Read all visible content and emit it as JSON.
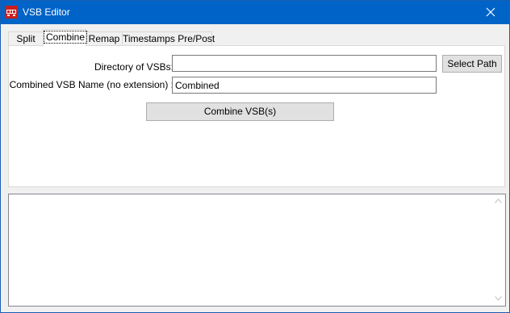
{
  "window": {
    "title": "VSB Editor",
    "accent_color": "#0063c7",
    "icons": {
      "app": "vsb-app-icon",
      "close": "close-icon"
    }
  },
  "tabs": [
    {
      "label": "Split",
      "active": false
    },
    {
      "label": "Combine",
      "active": true
    },
    {
      "label": "Remap",
      "active": false
    },
    {
      "label": "Timestamps Pre/Post",
      "active": false
    }
  ],
  "combine": {
    "directory_label": "Directory of VSBs:",
    "directory_value": "",
    "select_path_label": "Select Path",
    "name_label": "Combined VSB Name (no extension) :",
    "name_value": "Combined",
    "combine_button_label": "Combine VSB(s)"
  },
  "output": {
    "text": "",
    "scroll_icons": [
      "scroll-up-arrow-icon",
      "scroll-down-arrow-icon"
    ]
  }
}
